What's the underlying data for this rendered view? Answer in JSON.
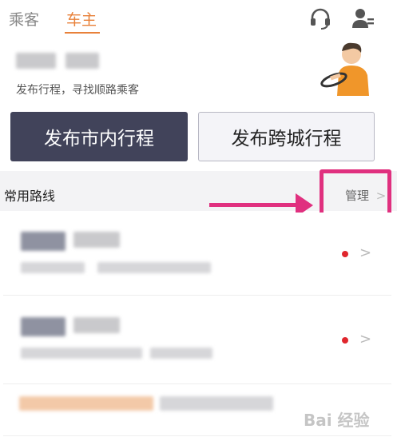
{
  "tabs": {
    "passenger_label": "乘客",
    "driver_label": "车主",
    "active": "车主"
  },
  "header_icons": [
    "headset-icon",
    "profile-icon"
  ],
  "intro": {
    "description": "发布行程，寻找顺路乘客"
  },
  "buttons": {
    "city_trip": "发布市内行程",
    "intercity_trip": "发布跨城行程"
  },
  "routes_section": {
    "title": "常用路线",
    "manage_label": "管理"
  },
  "colors": {
    "accent": "#e8813a",
    "primary_button": "#41435a",
    "annotation": "#e0307f",
    "status_dot": "#e0262d"
  },
  "watermark": "Bai 经验"
}
